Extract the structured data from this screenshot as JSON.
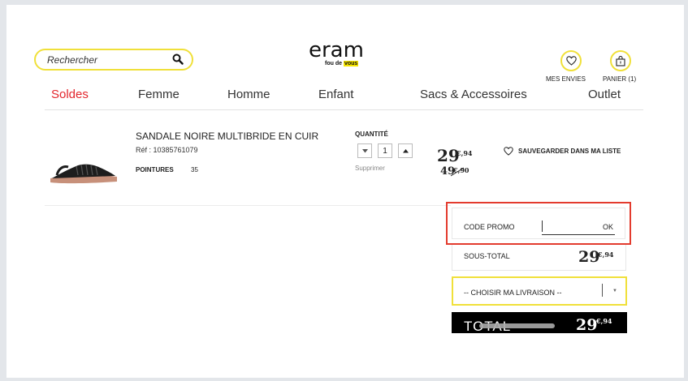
{
  "search": {
    "placeholder": "Rechercher"
  },
  "logo": {
    "word": "eram",
    "tagline_prefix": "fou de ",
    "tagline_highlight": "vous"
  },
  "header_icons": {
    "wishlist_label": "MES ENVIES",
    "cart_label": "PANIER (1)"
  },
  "nav": [
    "Soldes",
    "Femme",
    "Homme",
    "Enfant",
    "Sacs & Accessoires",
    "Outlet"
  ],
  "colors": {
    "accent_yellow": "#f0e03a",
    "sale_red": "#e3262d",
    "promo_border": "#e33b2e"
  },
  "product": {
    "title": "SANDALE NOIRE MULTIBRIDE EN CUIR",
    "ref": "Réf : 10385761079",
    "size_label": "POINTURES",
    "size_value": "35",
    "quantity_label": "QUANTITÉ",
    "quantity": "1",
    "remove_label": "Supprimer",
    "price_int": "29",
    "price_cents": "€,94",
    "old_price_int": "49",
    "old_price_cents": "€,90",
    "save_label": "SAUVEGARDER DANS MA LISTE"
  },
  "summary": {
    "promo_label": "CODE PROMO",
    "promo_ok": "OK",
    "subtotal_label": "SOUS-TOTAL",
    "subtotal_int": "29",
    "subtotal_cents": "€,94",
    "delivery_placeholder": "-- CHOISIR MA LIVRAISON --",
    "total_label": "TOTAL",
    "total_int": "29",
    "total_cents": "€,94"
  }
}
